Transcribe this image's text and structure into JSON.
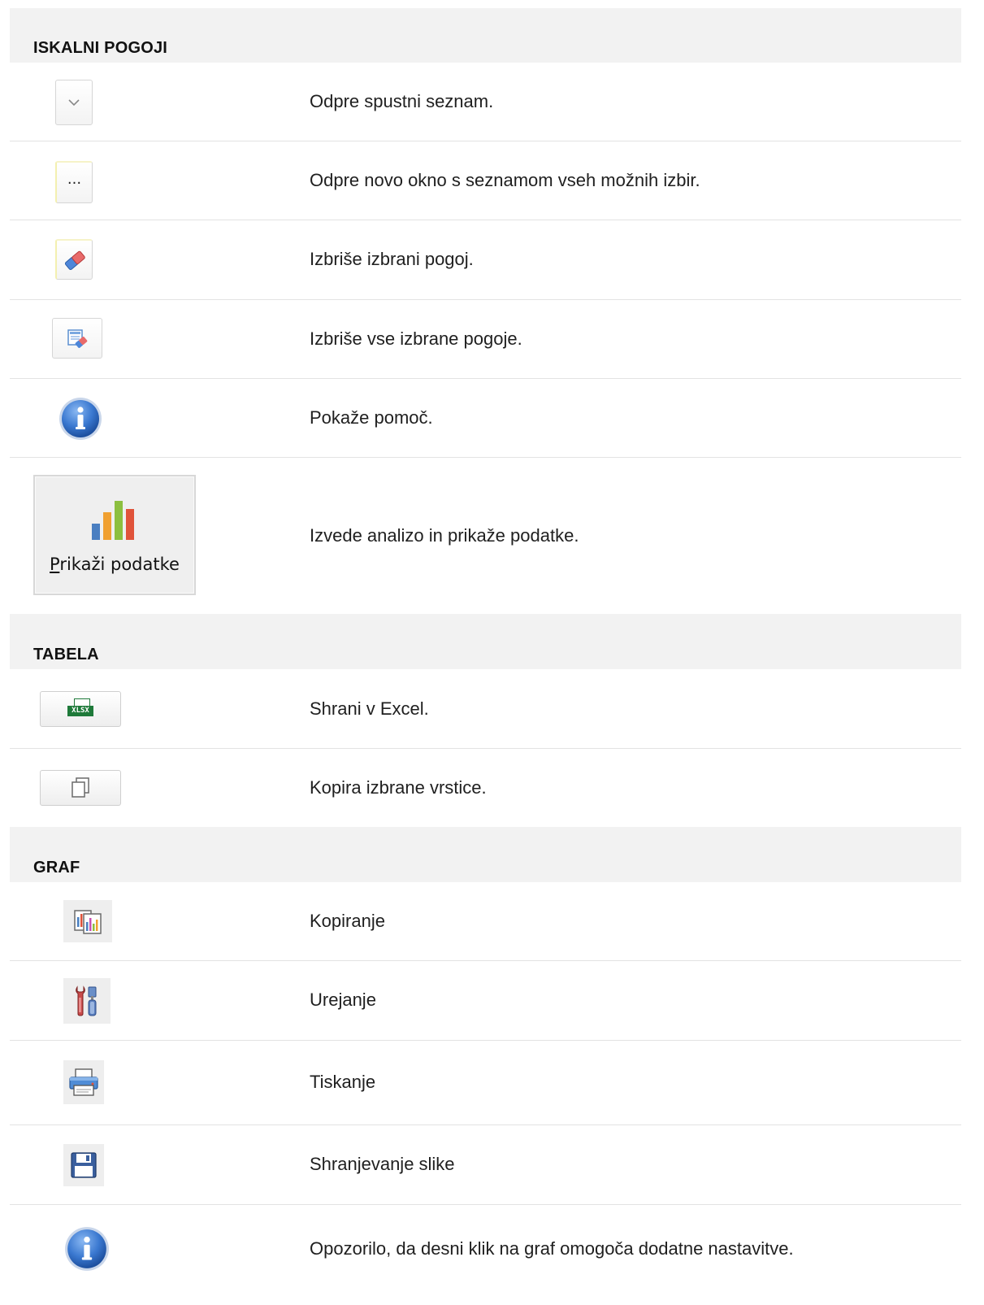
{
  "sections": {
    "iskalni": {
      "title": "ISKALNI POGOJI",
      "rows": [
        {
          "icon": "chevron-down-icon",
          "desc": "Odpre spustni seznam."
        },
        {
          "icon": "ellipsis-icon",
          "label": "...",
          "desc": "Odpre novo okno s seznamom vseh možnih izbir."
        },
        {
          "icon": "eraser-icon",
          "desc": "Izbriše izbrani pogoj."
        },
        {
          "icon": "clear-all-icon",
          "desc": "Izbriše vse izbrane pogoje."
        },
        {
          "icon": "info-icon",
          "desc": "Pokaže pomoč."
        },
        {
          "icon": "bar-chart-icon",
          "button_label_first": "P",
          "button_label_rest": "rikaži podatke",
          "desc": "Izvede analizo in prikaže podatke."
        }
      ]
    },
    "tabela": {
      "title": "TABELA",
      "rows": [
        {
          "icon": "xlsx-icon",
          "label": "XLSX",
          "desc": "Shrani v Excel."
        },
        {
          "icon": "copy-icon",
          "desc": "Kopira izbrane vrstice."
        }
      ]
    },
    "graf": {
      "title": "GRAF",
      "rows": [
        {
          "icon": "copy-chart-icon",
          "desc": "Kopiranje"
        },
        {
          "icon": "tools-icon",
          "desc": "Urejanje"
        },
        {
          "icon": "printer-icon",
          "desc": "Tiskanje"
        },
        {
          "icon": "floppy-disk-icon",
          "desc": "Shranjevanje slike"
        },
        {
          "icon": "info-icon",
          "desc": "Opozorilo, da desni klik na graf omogoča dodatne nastavitve."
        }
      ]
    }
  },
  "colors": {
    "section_bg": "#f2f2f2",
    "divider": "#e3e3e3",
    "info_blue": "#2f6fc8",
    "bar_blue": "#4a7fc1",
    "bar_orange": "#f0a030",
    "bar_green": "#8cbf3f",
    "bar_red": "#e0533a"
  }
}
